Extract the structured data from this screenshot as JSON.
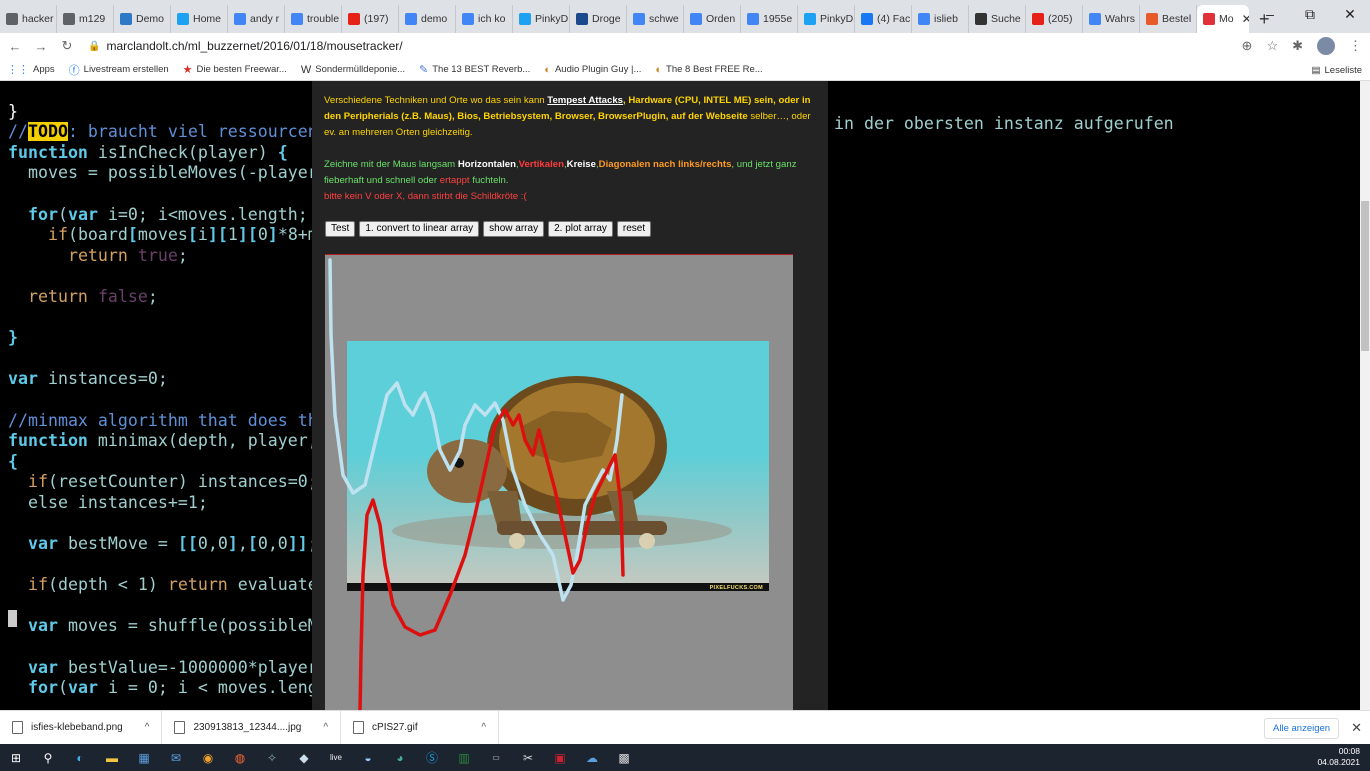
{
  "tabs": [
    {
      "label": "hacker",
      "color": "#5f6368"
    },
    {
      "label": "m129",
      "color": "#5f6368"
    },
    {
      "label": "Demo",
      "color": "#2d79c7"
    },
    {
      "label": "Home",
      "color": "#1da1f2"
    },
    {
      "label": "andy r",
      "color": "#4285f4"
    },
    {
      "label": "trouble",
      "color": "#4285f4"
    },
    {
      "label": "(197)",
      "color": "#e62117"
    },
    {
      "label": "demo",
      "color": "#4285f4"
    },
    {
      "label": "ich ko",
      "color": "#4285f4"
    },
    {
      "label": "PinkyD",
      "color": "#1da1f2"
    },
    {
      "label": "Droge",
      "color": "#1a4a8c"
    },
    {
      "label": "schwe",
      "color": "#4285f4"
    },
    {
      "label": "Orden",
      "color": "#4285f4"
    },
    {
      "label": "1955e",
      "color": "#4285f4"
    },
    {
      "label": "PinkyD",
      "color": "#1da1f2"
    },
    {
      "label": "(4) Fac",
      "color": "#1877f2"
    },
    {
      "label": "islieb",
      "color": "#4285f4"
    },
    {
      "label": "Suche",
      "color": "#333333"
    },
    {
      "label": "(205)",
      "color": "#e62117"
    },
    {
      "label": "Wahrs",
      "color": "#4285f4"
    },
    {
      "label": "Bestel",
      "color": "#e85a2a"
    }
  ],
  "active_tab": {
    "label": "Mo",
    "color": "#e0303a"
  },
  "window_controls": {
    "minimize": "–",
    "maximize": "⧉",
    "close": "✕"
  },
  "address": {
    "url": "marclandolt.ch/ml_buzzernet/2016/01/18/mousetracker/"
  },
  "bookmarks": [
    {
      "label": "Apps",
      "icon": "apps-icon"
    },
    {
      "label": "Livestream erstellen",
      "icon": "facebook-icon"
    },
    {
      "label": "Die besten Freewar...",
      "icon": "star-icon"
    },
    {
      "label": "Sondermülldeponie...",
      "icon": "wiki-icon"
    },
    {
      "label": "The 13 BEST Reverb...",
      "icon": "feather-icon"
    },
    {
      "label": "Audio Plugin Guy |...",
      "icon": "plugin-icon"
    },
    {
      "label": "The 8 Best FREE Re...",
      "icon": "plugin-icon"
    }
  ],
  "reading_list": "Leseliste",
  "code_right": "in der obersten instanz aufgerufen",
  "panel": {
    "p1_a": "Verschiedene Techniken und Orte wo das sein kann ",
    "p1_link": "Tempest Attacks",
    "p1_b": ", Hardware (CPU, INTEL ME) sein, oder in den Peripherials (z.B. Maus), Bios, Betriebsystem, Browser, BrowserPlugin, auf der Webseite",
    "p1_c": " selber…, oder ev. an mehreren Orten gleichzeitig.",
    "p2_a": "Zeichne mit der Maus langsam ",
    "p2_h": "Horizontalen",
    "p2_comma1": ",",
    "p2_v": "Vertikalen",
    "p2_comma2": ",",
    "p2_k": "Kreise",
    "p2_comma3": ",",
    "p2_d": "Diagonalen nach links/rechts",
    "p2_b": ", und jetzt ganz fieberhaft und schnell oder ",
    "p2_e": "ertappt",
    "p2_c": " fuchteln.",
    "p3": "bitte kein V oder X, dann stirbt die Schildkröte :(",
    "buttons": [
      "Test",
      "1. convert to linear array",
      "show array",
      "2. plot array",
      "reset"
    ],
    "photo_credit": "PIXELFUCKS.COM"
  },
  "downloads": [
    {
      "name": "isfies-klebeband.png"
    },
    {
      "name": "230913813_12344....jpg"
    },
    {
      "name": "cPIS27.gif"
    }
  ],
  "show_all": "Alle anzeigen",
  "clock": {
    "time": "00:08",
    "date": "04.08.2021"
  }
}
